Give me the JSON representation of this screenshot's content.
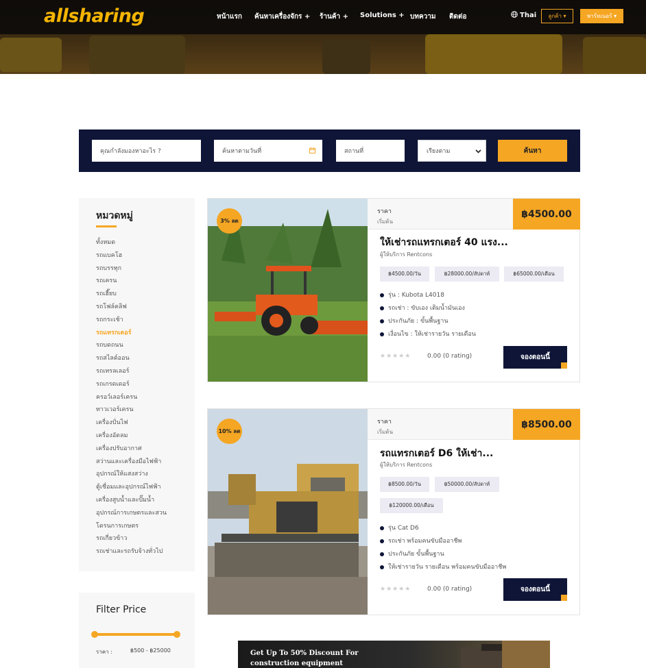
{
  "header": {
    "logo": "allsharing",
    "nav": [
      {
        "label": "หน้าแรก"
      },
      {
        "label": "ค้นหาเครื่องจักร +"
      },
      {
        "label": "ร้านค้า +"
      },
      {
        "label": "Solutions +"
      },
      {
        "label": "บทความ"
      },
      {
        "label": "ติดต่อ"
      }
    ],
    "language": "Thai",
    "customer_label": "ลูกค้า ▾",
    "partner_label": "พาร์ทเนอร์ ▾"
  },
  "search": {
    "keyword_placeholder": "คุณกำลังมองหาอะไร ?",
    "date_placeholder": "ค้นหาตามวันที่",
    "location_placeholder": "สถานที่",
    "sort_label": "เรียงตาม",
    "submit_label": "ค้นหา"
  },
  "sidebar": {
    "title": "หมวดหมู่",
    "categories": [
      {
        "label": "ทั้งหมด"
      },
      {
        "label": "รถแบคโฮ"
      },
      {
        "label": "รถบรรทุก"
      },
      {
        "label": "รถเครน"
      },
      {
        "label": "รถเฮี๊ยบ"
      },
      {
        "label": "รถโฟล์คลิฟ"
      },
      {
        "label": "รถกระเช้า"
      },
      {
        "label": "รถแทรกเตอร์"
      },
      {
        "label": "รถบดถนน"
      },
      {
        "label": "รถสไลด์ออน"
      },
      {
        "label": "รถเทรลเลอร์"
      },
      {
        "label": "รถเกรดเดอร์"
      },
      {
        "label": "ครอว์เลอร์เครน"
      },
      {
        "label": "ทาวเวอร์เครน"
      },
      {
        "label": "เครื่องปั่นไฟ"
      },
      {
        "label": "เครื่องอัดลม"
      },
      {
        "label": "เครื่องปรับอากาศ"
      },
      {
        "label": "สว่านและเครื่องมือไฟฟ้า"
      },
      {
        "label": "อุปกรณ์ให้แสงสว่าง"
      },
      {
        "label": "ตู้เชื่อมและอุปกรณ์ไฟฟ้า"
      },
      {
        "label": "เครื่องสูบน้ำและปั๊มน้ำ"
      },
      {
        "label": "อุปกรณ์การเกษตรและสวน"
      },
      {
        "label": "โดรนการเกษตร"
      },
      {
        "label": "รถเกี่ยวข้าว"
      },
      {
        "label": "รถเช่าและรถรับจ้างทั่วไป"
      }
    ],
    "active_category": "รถแทรกเตอร์"
  },
  "filter": {
    "title": "Filter Price",
    "price_label": "ราคา :",
    "price_range": "฿500 - ฿25000",
    "range_min_fraction": 0,
    "range_max_fraction": 1
  },
  "listings": [
    {
      "discount": "3% ลด",
      "price_label": "ราคา",
      "price_sub": "เริ่มต้น",
      "price": "฿4500.00",
      "title": "ให้เช่ารถแทรกเตอร์ 40 แรง...",
      "provider": "ผู้ให้บริการ Rentcons",
      "rates": [
        "฿4500.00/วัน",
        "฿28000.00/สัปดาห์",
        "฿65000.00/เดือน"
      ],
      "specs": [
        "รุ่น : Kubota L4018",
        "รถเช่า : ขับเอง เติมน้ำมันเอง",
        "ประกันภัย : ขั้นพื้นฐาน",
        "เงื่อนไข : ให้เช่ารายวัน รายเดือน"
      ],
      "rating": "0.00 (0 rating)",
      "stars": "★★★★★",
      "book_label": "จองตอนนี้"
    },
    {
      "discount": "10% ลด",
      "price_label": "ราคา",
      "price_sub": "เริ่มต้น",
      "price": "฿8500.00",
      "title": "รถแทรกเตอร์ D6 ให้เช่า...",
      "provider": "ผู้ให้บริการ Rentcons",
      "rates": [
        "฿8500.00/วัน",
        "฿50000.00/สัปดาห์",
        "฿120000.00/เดือน"
      ],
      "specs": [
        "รุ่น Cat D6",
        "รถเช่า พร้อมคนขับมืออาชีพ",
        "ประกันภัย ขั้นพื้นฐาน",
        "ให้เช่ารายวัน รายเดือน พร้อมคนขับมืออาชีพ"
      ],
      "rating": "0.00 (0 rating)",
      "stars": "★★★★★",
      "book_label": "จองตอนนี้"
    }
  ],
  "promo": {
    "line1": "Get Up To 50% Discount For",
    "line2": "construction equipment"
  },
  "colors": {
    "accent": "#f5a623",
    "navy": "#0e1537"
  }
}
